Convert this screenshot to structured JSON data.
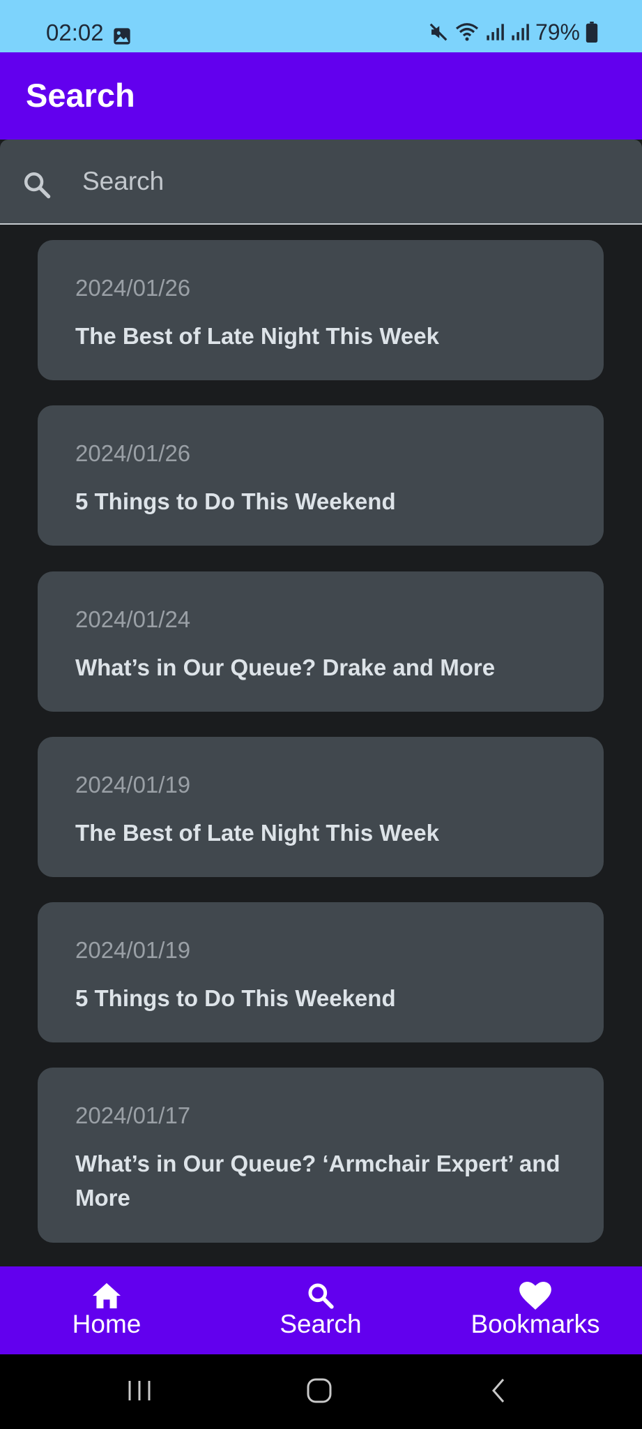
{
  "status_bar": {
    "time": "02:02",
    "battery": "79%",
    "icons": [
      "photo-icon",
      "mute-icon",
      "wifi-icon",
      "signal-icon",
      "signal-icon",
      "battery-icon"
    ]
  },
  "app_bar": {
    "title": "Search"
  },
  "search": {
    "placeholder": "Search",
    "value": ""
  },
  "results": [
    {
      "date": "2024/01/26",
      "title": "The Best of Late Night This Week"
    },
    {
      "date": "2024/01/26",
      "title": "5 Things to Do This Weekend"
    },
    {
      "date": "2024/01/24",
      "title": "What’s in Our Queue? Drake and More"
    },
    {
      "date": "2024/01/19",
      "title": "The Best of Late Night This Week"
    },
    {
      "date": "2024/01/19",
      "title": "5 Things to Do This Weekend"
    },
    {
      "date": "2024/01/17",
      "title": "What’s in Our Queue? ‘Armchair Expert’ and More"
    }
  ],
  "bottom_nav": {
    "items": [
      {
        "label": "Home",
        "icon": "home-icon"
      },
      {
        "label": "Search",
        "icon": "search-icon"
      },
      {
        "label": "Bookmarks",
        "icon": "heart-icon"
      }
    ]
  },
  "colors": {
    "primary": "#6200ee",
    "status_bar": "#7dd3fc",
    "background": "#1a1c1e",
    "card": "#41484e"
  }
}
